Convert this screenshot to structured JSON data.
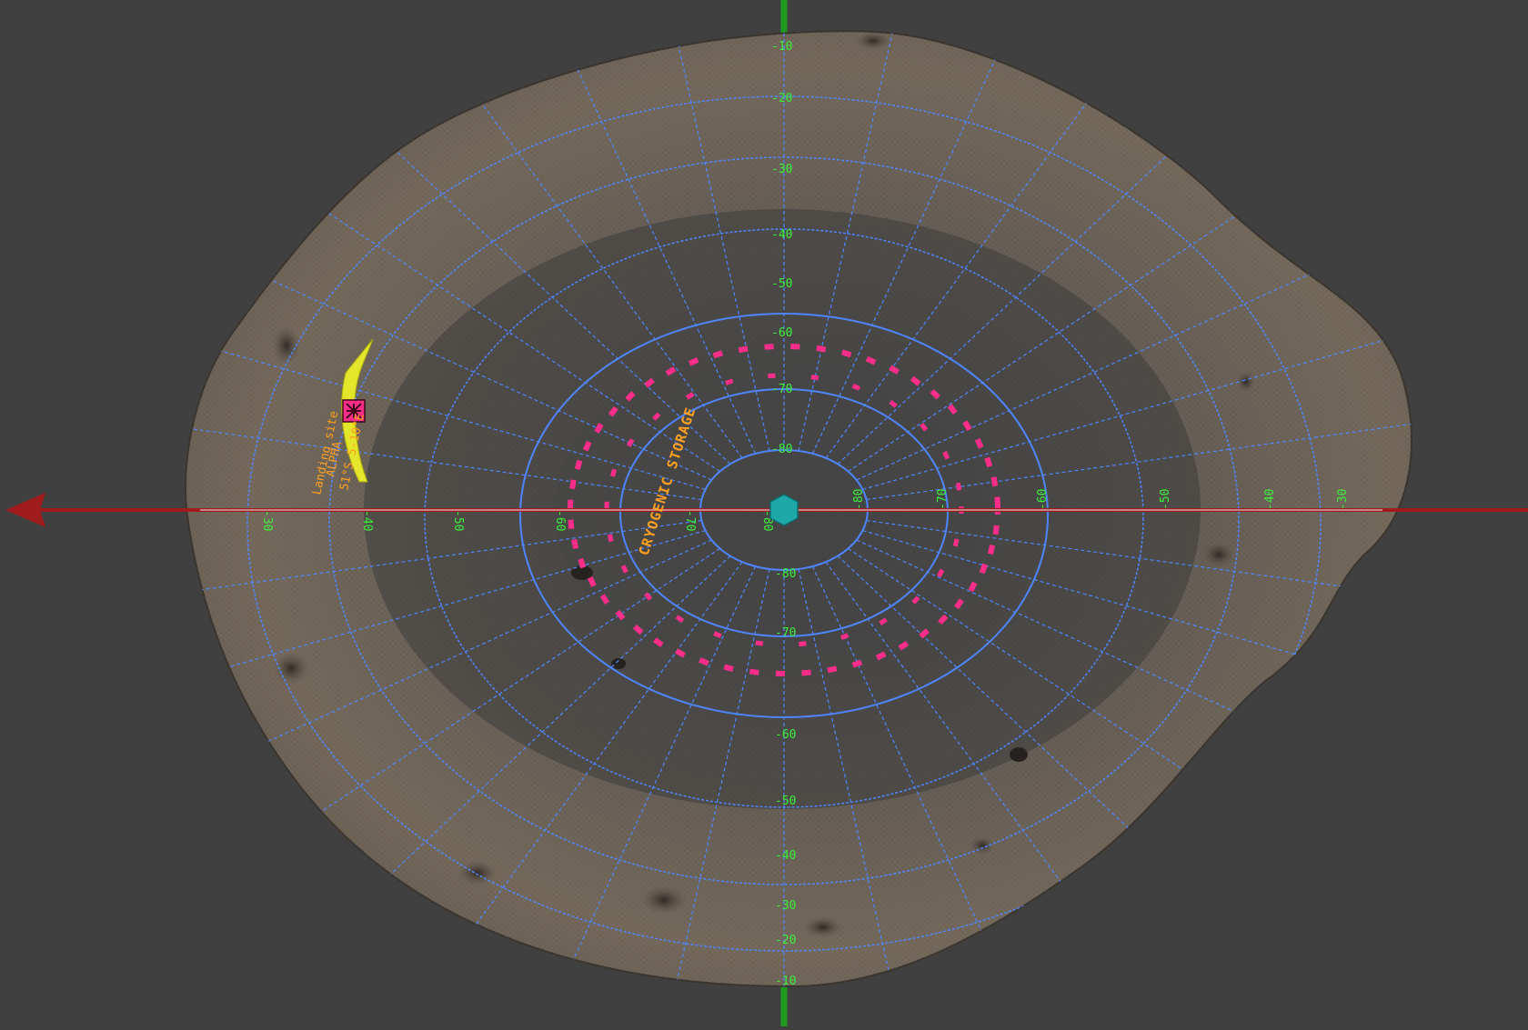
{
  "viewport": {
    "background": "#404040",
    "axis_x_color": "#a01c1c",
    "axis_y_color": "#1f9a1f"
  },
  "moon": {
    "surface_color": "#6e645a",
    "grid_color": "#4f86ff",
    "label_green": "#3cf03c",
    "label_magenta": "#ff2d8a",
    "label_orange": "#ffa020"
  },
  "landing_site": {
    "title": "Landing site",
    "name": "ALPHA",
    "coords": "51°S 5-10°E",
    "marker_color": "#e3e62a",
    "icon": "maltese-cross-icon"
  },
  "zone_label": "CRYOGENIC STORAGE",
  "center_marker": {
    "icon": "hexagon-icon",
    "color": "#1fa8a8"
  },
  "scale_labels": {
    "north": [
      "-10",
      "-20",
      "-30",
      "-40",
      "-50",
      "-60",
      "-70",
      "-80"
    ],
    "south": [
      "-80",
      "-70",
      "-60",
      "-50",
      "-40",
      "-30",
      "-20",
      "-10"
    ],
    "west": [
      "-30",
      "-40",
      "-50",
      "-60",
      "-70",
      "-80"
    ],
    "east": [
      "-80",
      "-70",
      "-60",
      "-50",
      "-40",
      "-30"
    ]
  }
}
